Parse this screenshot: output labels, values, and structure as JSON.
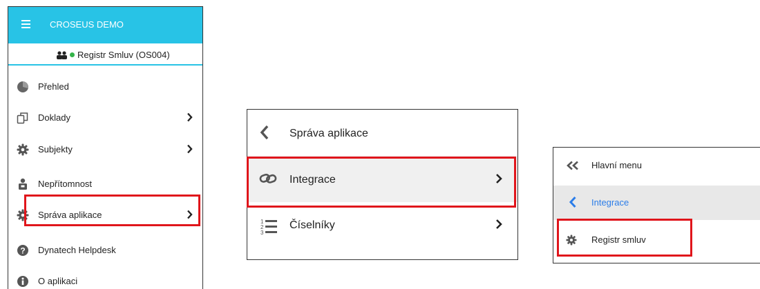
{
  "panel1": {
    "app_title": "CROSEUS DEMO",
    "user_label": "Registr Smluv (OS004)",
    "accent_color": "#28c3e6",
    "items": [
      {
        "label": "Přehled",
        "icon": "pie-chart-icon",
        "has_submenu": false
      },
      {
        "label": "Doklady",
        "icon": "copy-documents-icon",
        "has_submenu": true
      },
      {
        "label": "Subjekty",
        "icon": "gear-icon",
        "has_submenu": true
      },
      {
        "label": "Nepřítomnost",
        "icon": "user-suitcase-icon",
        "has_submenu": false
      },
      {
        "label": "Správa aplikace",
        "icon": "gear-icon",
        "has_submenu": true,
        "highlighted": true
      },
      {
        "label": "Dynatech Helpdesk",
        "icon": "question-circle-icon",
        "has_submenu": false
      },
      {
        "label": "O aplikaci",
        "icon": "info-circle-icon",
        "has_submenu": false
      }
    ]
  },
  "panel2": {
    "back_label": "Správa aplikace",
    "items": [
      {
        "label": "Integrace",
        "icon": "link-icon",
        "has_submenu": true,
        "highlighted": true
      },
      {
        "label": "Číselníky",
        "icon": "numbered-list-icon",
        "has_submenu": true
      }
    ]
  },
  "panel3": {
    "main_menu_label": "Hlavní menu",
    "parent_label": "Integrace",
    "parent_color": "#2b7de9",
    "items": [
      {
        "label": "Registr smluv",
        "icon": "gear-icon",
        "highlighted": true
      }
    ]
  },
  "highlight_color": "#e0151b"
}
